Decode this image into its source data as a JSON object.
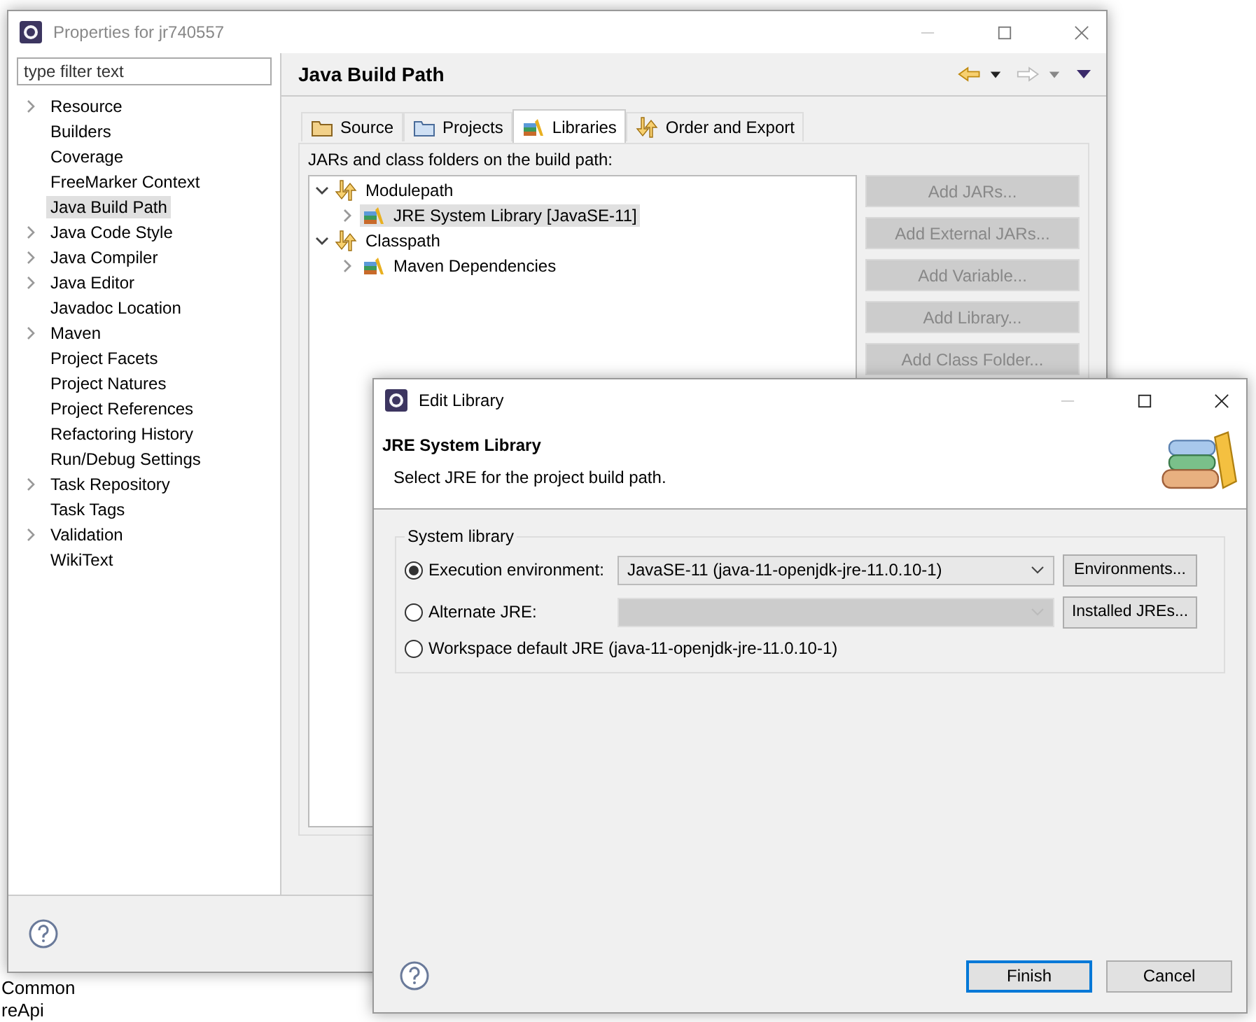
{
  "background": {
    "lines": [
      "Common",
      "reApi"
    ]
  },
  "properties_window": {
    "title": "Properties for jr740557",
    "filter": {
      "placeholder": "type filter text"
    },
    "nav_items": [
      {
        "label": "Resource",
        "expandable": true,
        "selected": false
      },
      {
        "label": "Builders",
        "expandable": false,
        "selected": false
      },
      {
        "label": "Coverage",
        "expandable": false,
        "selected": false
      },
      {
        "label": "FreeMarker Context",
        "expandable": false,
        "selected": false
      },
      {
        "label": "Java Build Path",
        "expandable": false,
        "selected": true
      },
      {
        "label": "Java Code Style",
        "expandable": true,
        "selected": false
      },
      {
        "label": "Java Compiler",
        "expandable": true,
        "selected": false
      },
      {
        "label": "Java Editor",
        "expandable": true,
        "selected": false
      },
      {
        "label": "Javadoc Location",
        "expandable": false,
        "selected": false
      },
      {
        "label": "Maven",
        "expandable": true,
        "selected": false
      },
      {
        "label": "Project Facets",
        "expandable": false,
        "selected": false
      },
      {
        "label": "Project Natures",
        "expandable": false,
        "selected": false
      },
      {
        "label": "Project References",
        "expandable": false,
        "selected": false
      },
      {
        "label": "Refactoring History",
        "expandable": false,
        "selected": false
      },
      {
        "label": "Run/Debug Settings",
        "expandable": false,
        "selected": false
      },
      {
        "label": "Task Repository",
        "expandable": true,
        "selected": false
      },
      {
        "label": "Task Tags",
        "expandable": false,
        "selected": false
      },
      {
        "label": "Validation",
        "expandable": true,
        "selected": false
      },
      {
        "label": "WikiText",
        "expandable": false,
        "selected": false
      }
    ],
    "page_title": "Java Build Path",
    "tabs": [
      {
        "label": "Source",
        "kind": "source",
        "selected": false
      },
      {
        "label": "Projects",
        "kind": "projects",
        "selected": false
      },
      {
        "label": "Libraries",
        "kind": "libraries",
        "selected": true
      },
      {
        "label": "Order and Export",
        "kind": "order",
        "selected": false
      }
    ],
    "list_caption": "JARs and class folders on the build path:",
    "tree": [
      {
        "label": "Modulepath",
        "kind": "folder",
        "expanded": true,
        "selected": false,
        "children": [
          {
            "label": "JRE System Library [JavaSE-11]",
            "kind": "library",
            "expanded": false,
            "selected": true
          }
        ]
      },
      {
        "label": "Classpath",
        "kind": "folder",
        "expanded": true,
        "selected": false,
        "children": [
          {
            "label": "Maven Dependencies",
            "kind": "library",
            "expanded": false,
            "selected": false
          }
        ]
      }
    ],
    "buttons": [
      {
        "label": "Add JARs...",
        "disabled": true
      },
      {
        "label": "Add External JARs...",
        "disabled": true
      },
      {
        "label": "Add Variable...",
        "disabled": true
      },
      {
        "label": "Add Library...",
        "disabled": true
      },
      {
        "label": "Add Class Folder...",
        "disabled": true
      }
    ]
  },
  "edit_library": {
    "title": "Edit Library",
    "heading": "JRE System Library",
    "description": "Select JRE for the project build path.",
    "group_label": "System library",
    "options": [
      {
        "label": "Execution environment:",
        "kind": "combo",
        "selected": true,
        "disabled": false,
        "value": "JavaSE-11 (java-11-openjdk-jre-11.0.10-1)",
        "button": "Environments..."
      },
      {
        "label": "Alternate JRE:",
        "kind": "combo",
        "selected": false,
        "disabled": true,
        "button": "Installed JREs..."
      },
      {
        "label": "Workspace default JRE (java-11-openjdk-jre-11.0.10-1)",
        "kind": "plain",
        "selected": false
      }
    ],
    "buttons": [
      {
        "label": "Finish",
        "default": true
      },
      {
        "label": "Cancel",
        "default": false
      }
    ]
  }
}
